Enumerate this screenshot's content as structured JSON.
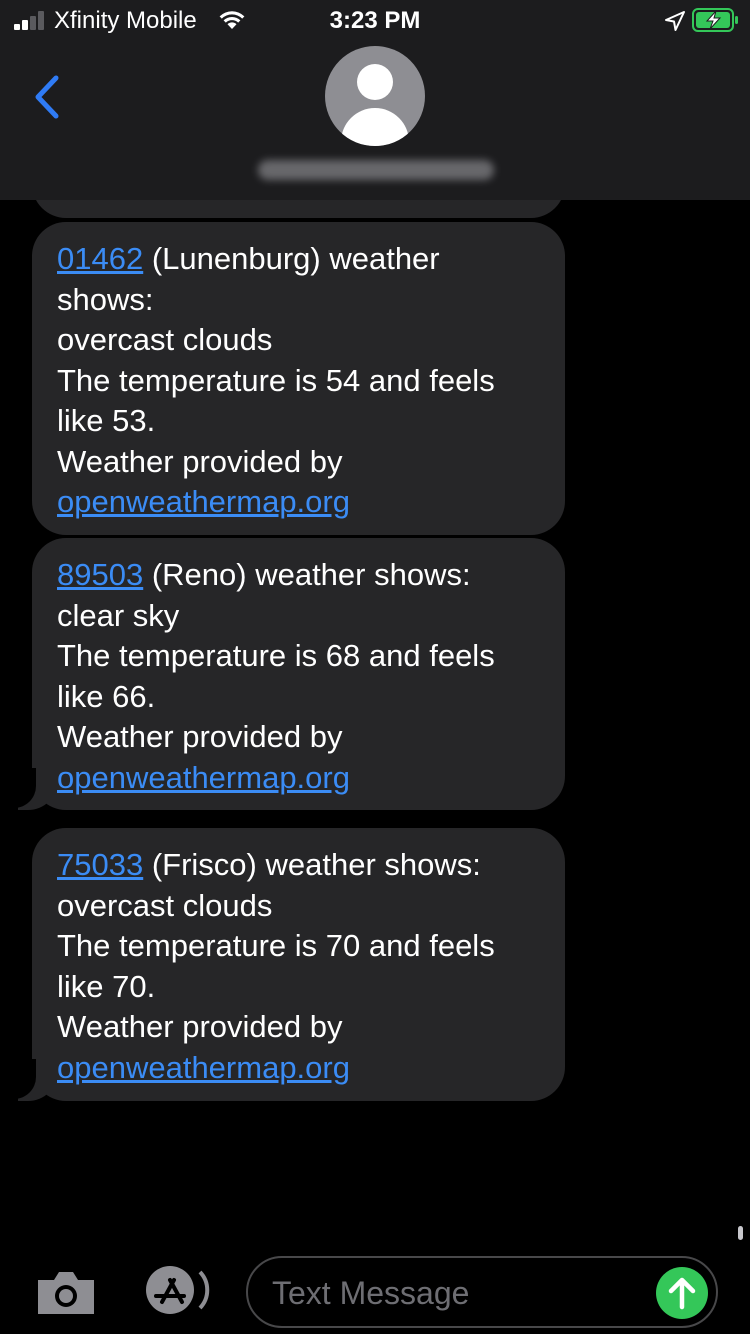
{
  "status_bar": {
    "carrier": "Xfinity Mobile",
    "time": "3:23 PM"
  },
  "colors": {
    "link": "#3b8cf5",
    "bubble": "#262628",
    "send": "#34c759",
    "header": "#1c1c1e"
  },
  "messages": [
    {
      "zip": "01462",
      "lines": [
        " (Lunenburg) weather",
        "shows:",
        "overcast clouds",
        "The temperature is 54 and feels",
        "like 53.",
        "Weather provided by"
      ],
      "source_link": "openweathermap.org"
    },
    {
      "zip": "89503",
      "lines": [
        " (Reno) weather shows:",
        "clear sky",
        "The temperature is 68 and feels",
        "like 66.",
        "Weather provided by"
      ],
      "source_link": "openweathermap.org"
    },
    {
      "zip": "75033",
      "lines": [
        " (Frisco) weather shows:",
        "overcast clouds",
        "The temperature is 70 and feels",
        "like 70.",
        "Weather provided by"
      ],
      "source_link": "openweathermap.org"
    }
  ],
  "input": {
    "placeholder": "Text Message"
  },
  "icons": {
    "back": "chevron-left-icon",
    "camera": "camera-icon",
    "apps": "app-store-icon",
    "send": "arrow-up-icon"
  }
}
